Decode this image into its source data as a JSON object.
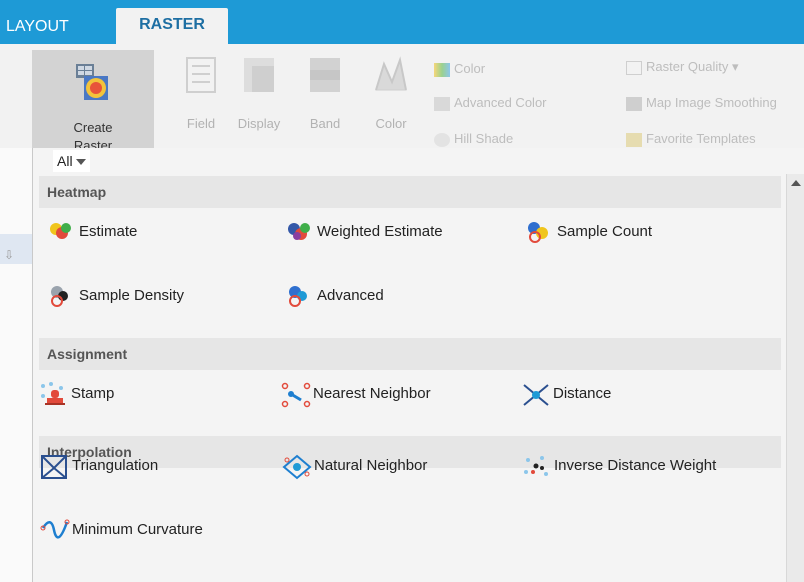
{
  "tabs": {
    "layout": "LAYOUT",
    "raster": "RASTER"
  },
  "ribbon": {
    "create_label": "Create",
    "create_label2": "Raster",
    "big_buttons": [
      "Field",
      "Display",
      "Band",
      "Color"
    ],
    "small_col1": [
      "Color",
      "Advanced Color",
      "Hill Shade"
    ],
    "small_col2": [
      "Raster Quality ▾",
      "Map Image Smoothing",
      "Favorite Templates"
    ]
  },
  "filter": {
    "value": "All"
  },
  "sections": {
    "heatmap": "Heatmap",
    "assignment": "Assignment",
    "interpolation": "Interpolation"
  },
  "heatmap_items": [
    "Estimate",
    "Weighted Estimate",
    "Sample Count",
    "Sample Density",
    "Advanced"
  ],
  "assignment_items": [
    "Stamp",
    "Nearest Neighbor",
    "Distance"
  ],
  "interpolation_items": [
    "Triangulation",
    "Natural Neighbor",
    "Inverse Distance Weight",
    "Minimum Curvature"
  ],
  "colors": {
    "accent": "#1e9ad6",
    "panel": "#f4f4f4",
    "section": "#e6e6e6"
  }
}
